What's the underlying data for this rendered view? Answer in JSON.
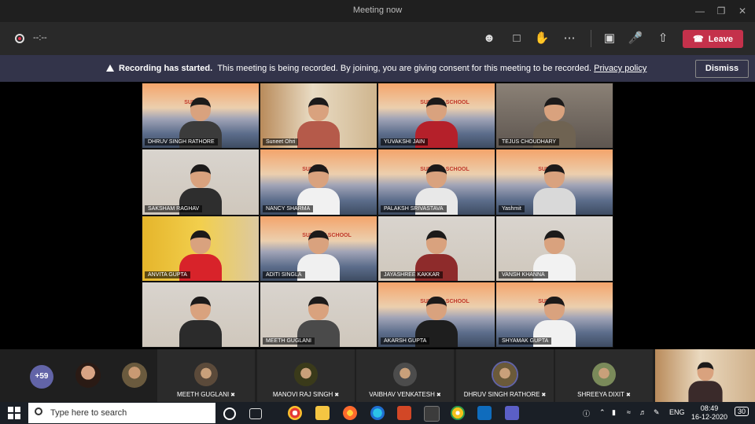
{
  "window": {
    "title": "Meeting now"
  },
  "toolbar": {
    "timer": "--:--",
    "leave_label": "Leave"
  },
  "banner": {
    "bold_text": "Recording has started.",
    "message": "This meeting is being recorded. By joining, you are giving consent for this meeting to be recorded.",
    "link_text": "Privacy policy",
    "dismiss_label": "Dismiss"
  },
  "grid": {
    "participants": [
      {
        "name": "DHRUV SINGH RATHORE",
        "bg": "beach",
        "shirt": "#3b3b3b",
        "school": "SUNCITY"
      },
      {
        "name": "Suneet Ohri",
        "bg": "room",
        "shirt": "#b55a4a",
        "school": ""
      },
      {
        "name": "YUVAKSHI JAIN",
        "bg": "beach",
        "shirt": "#b5202a",
        "school": "SUNCITY SCHOOL"
      },
      {
        "name": "TEJUS CHOUDHARY",
        "bg": "dark",
        "shirt": "#6f6352",
        "school": ""
      },
      {
        "name": "SAKSHAM RAGHAV",
        "bg": "wall",
        "shirt": "#2e2e2e",
        "school": ""
      },
      {
        "name": "NANCY SHARMA",
        "bg": "beach",
        "shirt": "#f1f1f1",
        "school": "SUNCITY"
      },
      {
        "name": "PALAKSH SRIVASTAVA",
        "bg": "beach",
        "shirt": "#e8e8e8",
        "school": "SUNCITY SCHOOL"
      },
      {
        "name": "Yashmit",
        "bg": "beach",
        "shirt": "#d9d9d9",
        "school": "SUNCITY"
      },
      {
        "name": "ANVITA GUPTA",
        "bg": "yellow",
        "shirt": "#d8232a",
        "school": ""
      },
      {
        "name": "ADITI SINGLA",
        "bg": "beach",
        "shirt": "#f0f0f0",
        "school": "SUNCITY SCHOOL"
      },
      {
        "name": "JAYASHREE KAKKAR",
        "bg": "wall",
        "shirt": "#8e2b2b",
        "school": ""
      },
      {
        "name": "VANSH KHANNA",
        "bg": "wall",
        "shirt": "#f2f2f2",
        "school": ""
      },
      {
        "name": "",
        "bg": "wall",
        "shirt": "#2b2b2b",
        "school": ""
      },
      {
        "name": "MEETH GUGLANI",
        "bg": "wall",
        "shirt": "#4a4a4a",
        "school": ""
      },
      {
        "name": "AKARSH GUPTA",
        "bg": "beach",
        "shirt": "#1e1e1e",
        "school": "SUNCITY SCHOOL"
      },
      {
        "name": "SHYAMAK GUPTA",
        "bg": "beach",
        "shirt": "#f1f1f1",
        "school": "SUNCITY"
      }
    ]
  },
  "roster": {
    "more_count": "+59",
    "tiles": [
      {
        "name": "MEETH GUGLANI",
        "avatar_color": "#5b4a3a"
      },
      {
        "name": "MANOVI RAJ SINGH",
        "avatar_color": "#3a3a1a"
      },
      {
        "name": "VAIBHAV VENKATESH",
        "avatar_color": "#4c4c4c"
      },
      {
        "name": "DHRUV SINGH RATHORE",
        "avatar_color": "#6b5a3a"
      },
      {
        "name": "SHREEYA DIXIT",
        "avatar_color": "#7a8a5a"
      }
    ]
  },
  "taskbar": {
    "search_placeholder": "Type here to search",
    "language": "ENG",
    "time": "08:49",
    "date": "16-12-2020",
    "notification_count": "30"
  }
}
